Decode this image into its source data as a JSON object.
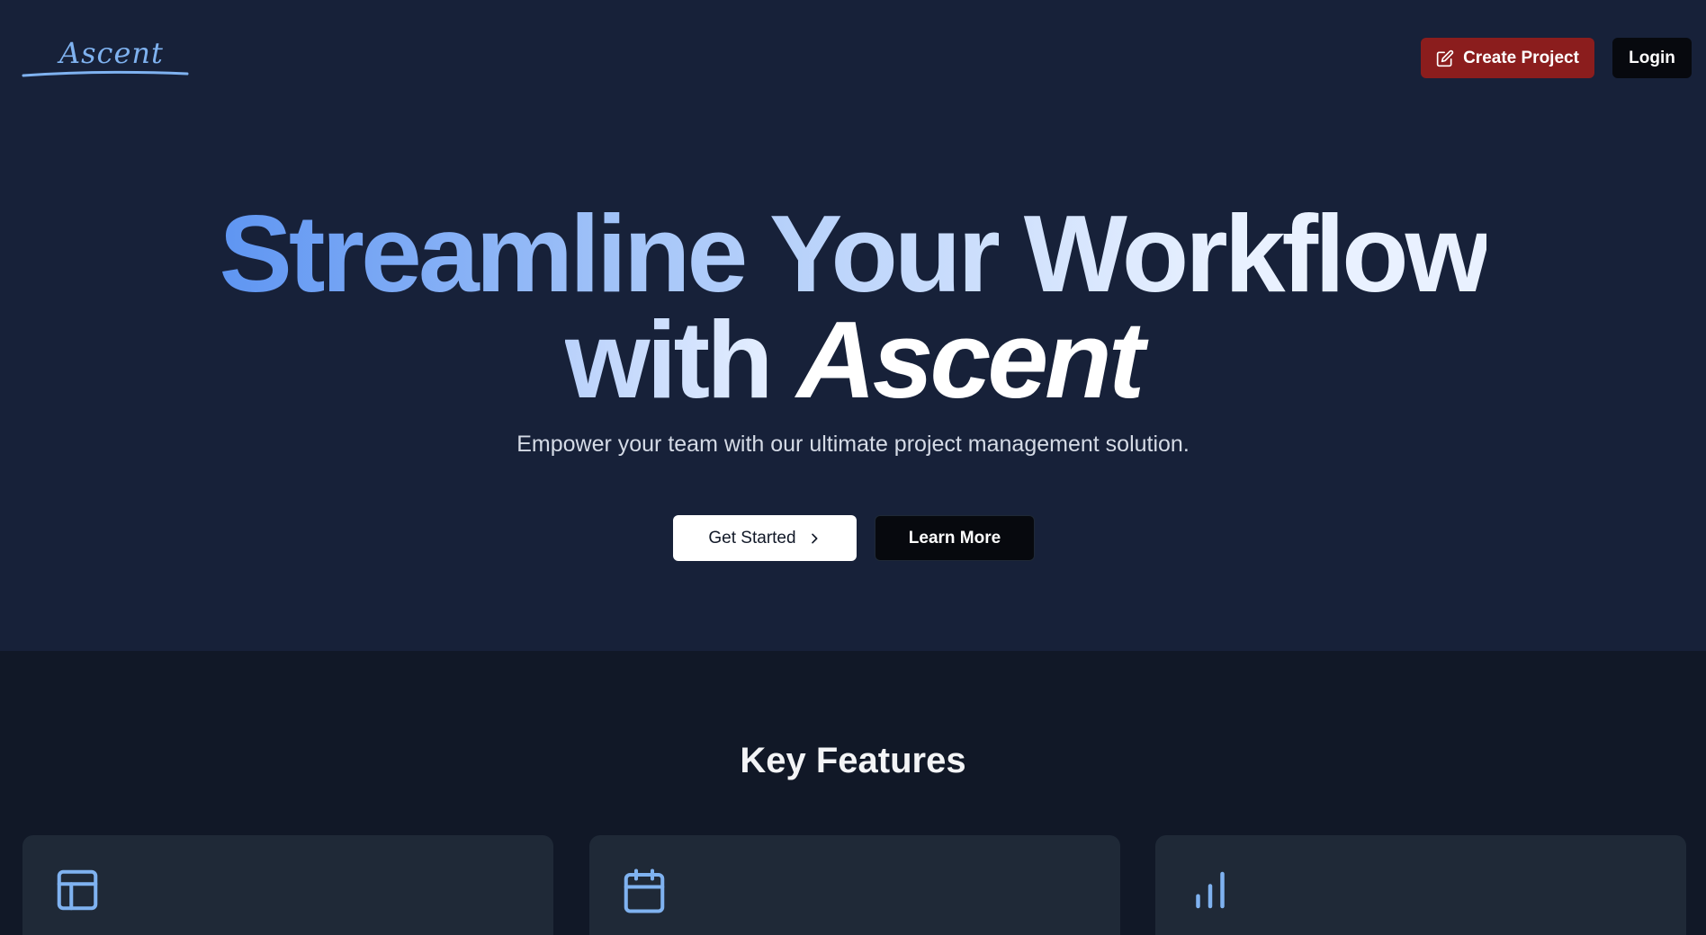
{
  "brand": {
    "name": "Ascent",
    "accent": "#7fb2f0"
  },
  "header": {
    "create_label": "Create Project",
    "login_label": "Login"
  },
  "hero": {
    "title_part1": "Streamline Your Workflow",
    "title_with": "with",
    "title_accent": "Ascent",
    "subtitle": "Empower your team with our ultimate project management solution.",
    "get_started_label": "Get Started",
    "learn_more_label": "Learn More"
  },
  "features": {
    "title": "Key Features",
    "cards": [
      {
        "icon": "layout-icon"
      },
      {
        "icon": "calendar-icon"
      },
      {
        "icon": "bar-chart-icon"
      }
    ]
  },
  "colors": {
    "background": "#172139",
    "features_background": "#111827",
    "card_background": "#1f2937",
    "create_button": "#8b1d1d",
    "dark_button": "#07090e",
    "icon_blue": "#7fb2f0"
  }
}
